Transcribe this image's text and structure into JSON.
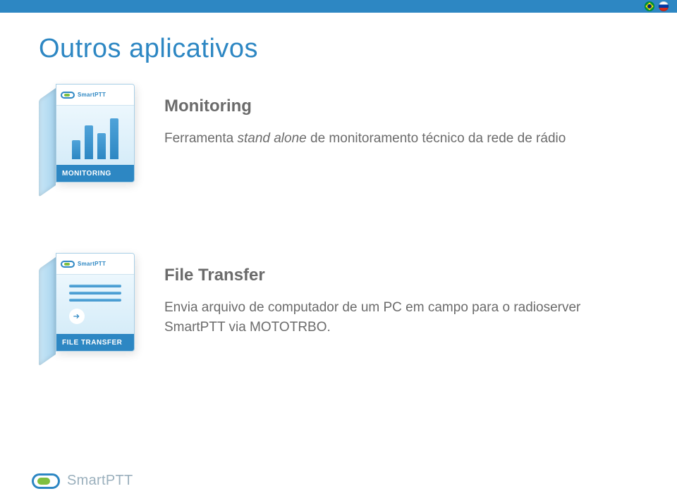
{
  "header": {
    "flags": [
      "brazil-flag-icon",
      "russia-flag-icon"
    ]
  },
  "title": "Outros aplicativos",
  "sections": [
    {
      "box_label": "MONITORING",
      "box_brand": "SmartPTT",
      "heading": "Monitoring",
      "description_pre": "Ferramenta ",
      "description_italic": "stand alone",
      "description_post": " de monitoramento técnico da rede de rádio"
    },
    {
      "box_label": "FILE TRANSFER",
      "box_brand": "SmartPTT",
      "heading": "File Transfer",
      "description_pre": "Envia arquivo de computador de um PC em campo para o radioserver SmartPTT via MOTOTRBO.",
      "description_italic": "",
      "description_post": ""
    }
  ],
  "footer": {
    "brand": "SmartPTT"
  }
}
